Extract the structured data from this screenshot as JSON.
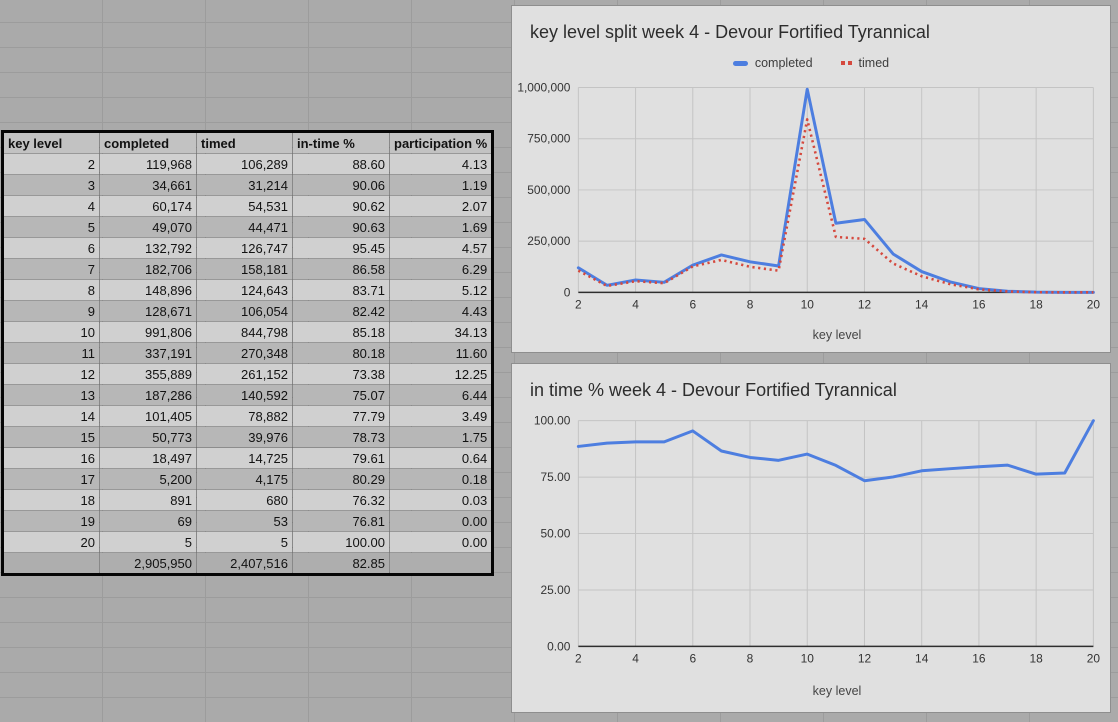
{
  "table": {
    "headers": [
      "key level",
      "completed",
      "timed",
      "in-time %",
      "participation %"
    ],
    "rows": [
      [
        "2",
        "119,968",
        "106,289",
        "88.60",
        "4.13"
      ],
      [
        "3",
        "34,661",
        "31,214",
        "90.06",
        "1.19"
      ],
      [
        "4",
        "60,174",
        "54,531",
        "90.62",
        "2.07"
      ],
      [
        "5",
        "49,070",
        "44,471",
        "90.63",
        "1.69"
      ],
      [
        "6",
        "132,792",
        "126,747",
        "95.45",
        "4.57"
      ],
      [
        "7",
        "182,706",
        "158,181",
        "86.58",
        "6.29"
      ],
      [
        "8",
        "148,896",
        "124,643",
        "83.71",
        "5.12"
      ],
      [
        "9",
        "128,671",
        "106,054",
        "82.42",
        "4.43"
      ],
      [
        "10",
        "991,806",
        "844,798",
        "85.18",
        "34.13"
      ],
      [
        "11",
        "337,191",
        "270,348",
        "80.18",
        "11.60"
      ],
      [
        "12",
        "355,889",
        "261,152",
        "73.38",
        "12.25"
      ],
      [
        "13",
        "187,286",
        "140,592",
        "75.07",
        "6.44"
      ],
      [
        "14",
        "101,405",
        "78,882",
        "77.79",
        "3.49"
      ],
      [
        "15",
        "50,773",
        "39,976",
        "78.73",
        "1.75"
      ],
      [
        "16",
        "18,497",
        "14,725",
        "79.61",
        "0.64"
      ],
      [
        "17",
        "5,200",
        "4,175",
        "80.29",
        "0.18"
      ],
      [
        "18",
        "891",
        "680",
        "76.32",
        "0.03"
      ],
      [
        "19",
        "69",
        "53",
        "76.81",
        "0.00"
      ],
      [
        "20",
        "5",
        "5",
        "100.00",
        "0.00"
      ]
    ],
    "total_row": [
      "",
      "2,905,950",
      "2,407,516",
      "82.85",
      ""
    ]
  },
  "chart_data": [
    {
      "type": "line",
      "title": "key level split week 4 - Devour Fortified Tyrannical",
      "xlabel": "key level",
      "x": [
        2,
        3,
        4,
        5,
        6,
        7,
        8,
        9,
        10,
        11,
        12,
        13,
        14,
        15,
        16,
        17,
        18,
        19,
        20
      ],
      "series": [
        {
          "name": "completed",
          "color": "#4d7ee0",
          "style": "solid",
          "values": [
            119968,
            34661,
            60174,
            49070,
            132792,
            182706,
            148896,
            128671,
            991806,
            337191,
            355889,
            187286,
            101405,
            50773,
            18497,
            5200,
            891,
            69,
            5
          ]
        },
        {
          "name": "timed",
          "color": "#d5493e",
          "style": "dotted",
          "values": [
            106289,
            31214,
            54531,
            44471,
            126747,
            158181,
            124643,
            106054,
            844798,
            270348,
            261152,
            140592,
            78882,
            39976,
            14725,
            4175,
            680,
            53,
            5
          ]
        }
      ],
      "ylim": [
        0,
        1000000
      ],
      "yticks": [
        0,
        250000,
        500000,
        750000,
        1000000
      ],
      "ytick_labels": [
        "0",
        "250,000",
        "500,000",
        "750,000",
        "1,000,000"
      ],
      "xticks": [
        2,
        4,
        6,
        8,
        10,
        12,
        14,
        16,
        18,
        20
      ],
      "grid": true,
      "legend_position": "top"
    },
    {
      "type": "line",
      "title": "in time % week 4 - Devour Fortified Tyrannical",
      "xlabel": "key level",
      "x": [
        2,
        3,
        4,
        5,
        6,
        7,
        8,
        9,
        10,
        11,
        12,
        13,
        14,
        15,
        16,
        17,
        18,
        19,
        20
      ],
      "series": [
        {
          "name": "in-time %",
          "color": "#4d7ee0",
          "style": "solid",
          "values": [
            88.6,
            90.06,
            90.62,
            90.63,
            95.45,
            86.58,
            83.71,
            82.42,
            85.18,
            80.18,
            73.38,
            75.07,
            77.79,
            78.73,
            79.61,
            80.29,
            76.32,
            76.81,
            100.0
          ]
        }
      ],
      "ylim": [
        0,
        100
      ],
      "yticks": [
        0,
        25,
        50,
        75,
        100
      ],
      "ytick_labels": [
        "0.00",
        "25.00",
        "50.00",
        "75.00",
        "100.00"
      ],
      "xticks": [
        2,
        4,
        6,
        8,
        10,
        12,
        14,
        16,
        18,
        20
      ],
      "grid": true,
      "legend_position": "none"
    }
  ]
}
